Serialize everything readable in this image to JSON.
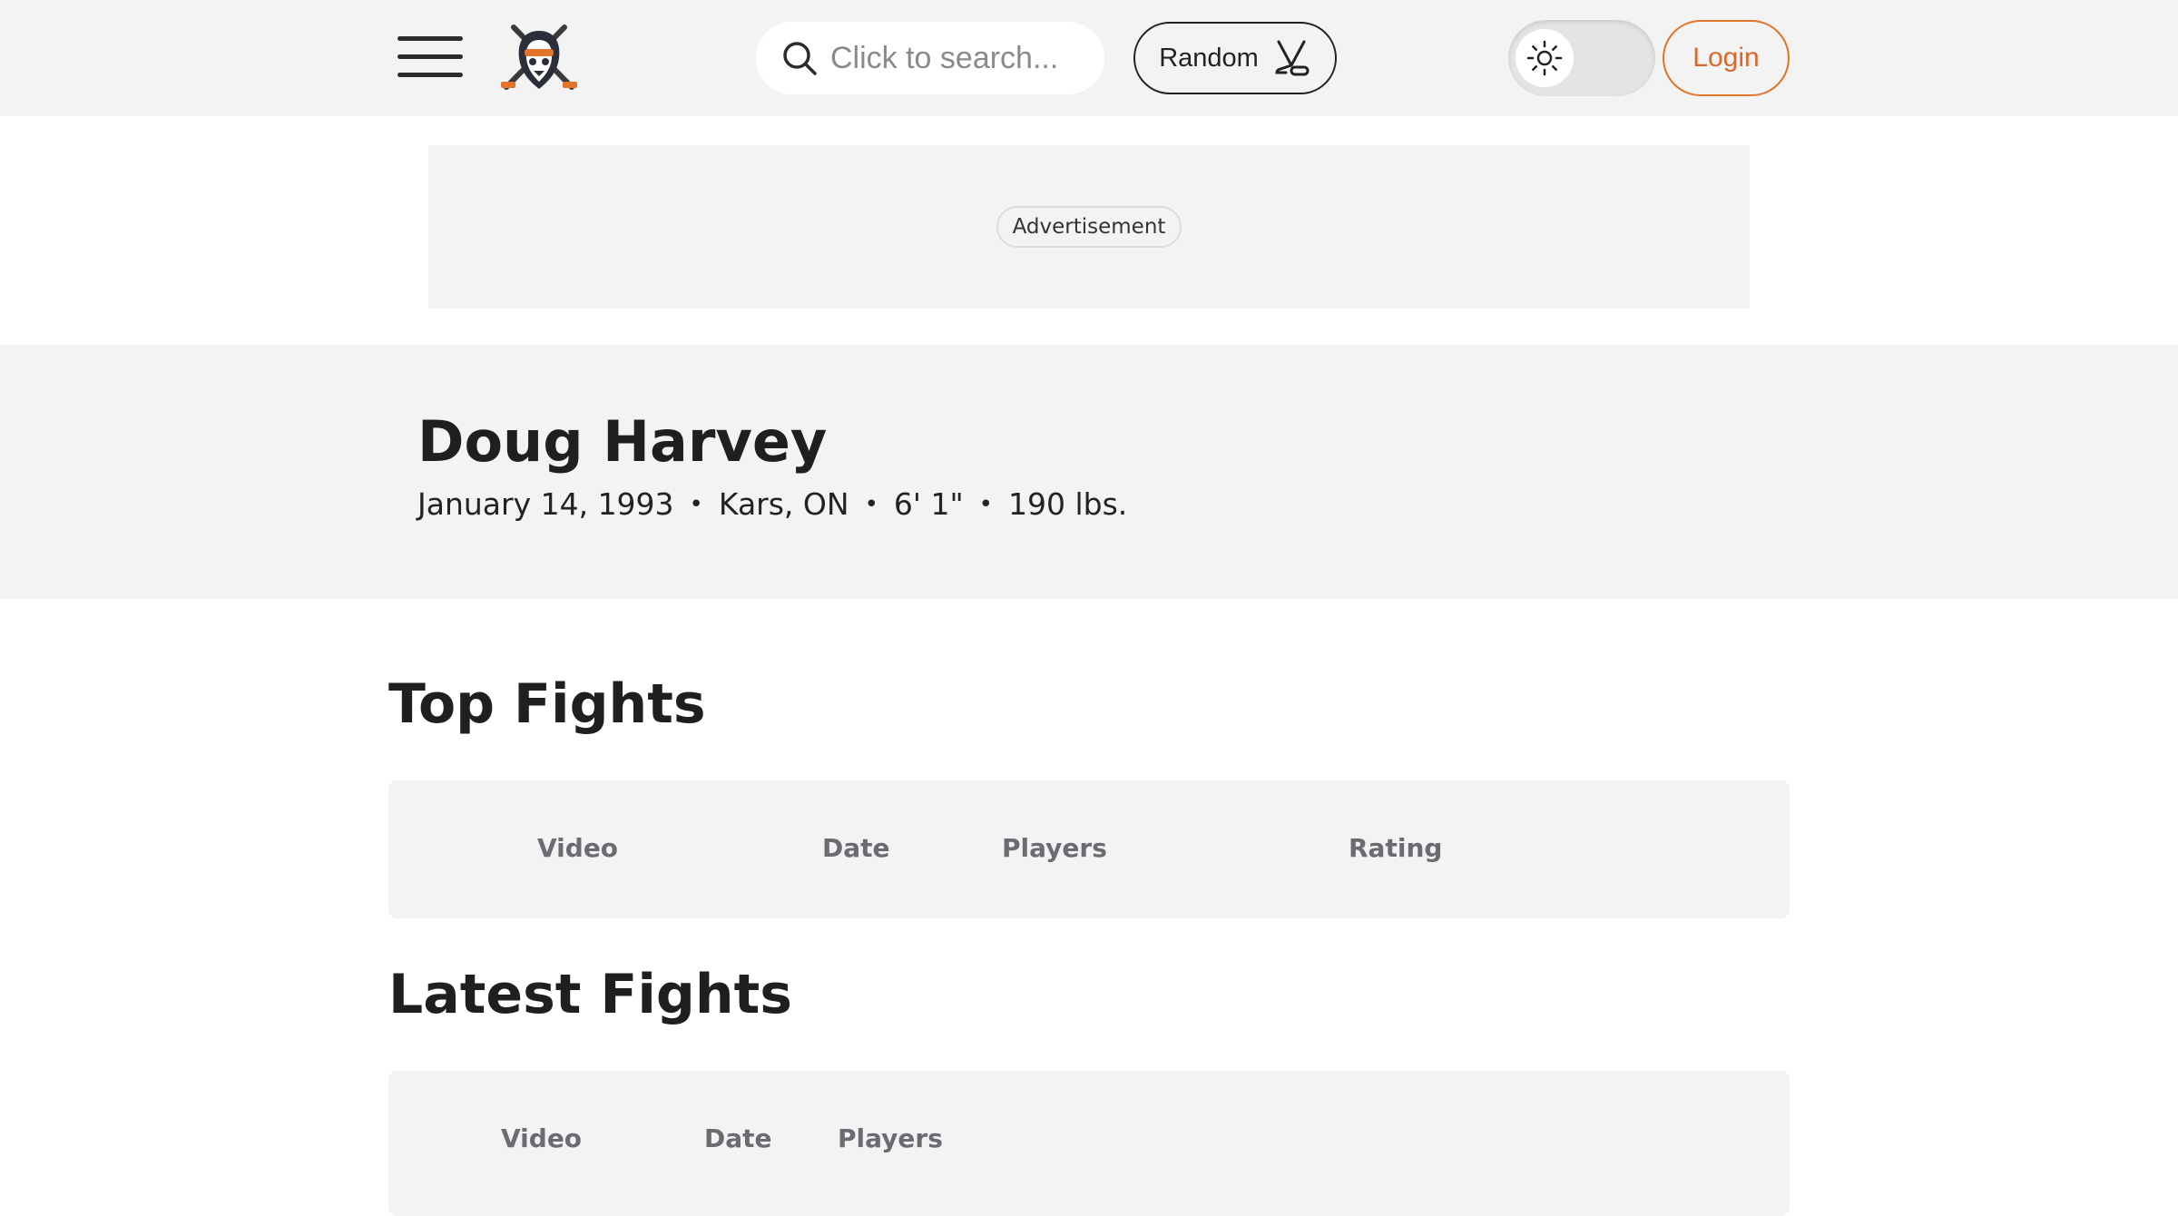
{
  "header": {
    "search_placeholder": "Click to search...",
    "random_label": "Random",
    "login_label": "Login"
  },
  "ad": {
    "label": "Advertisement"
  },
  "player": {
    "name": "Doug Harvey",
    "birth_date": "January 14, 1993",
    "hometown": "Kars, ON",
    "height": "6' 1\"",
    "weight": "190 lbs.",
    "separator": "•"
  },
  "top_fights": {
    "title": "Top Fights",
    "columns": [
      "Video",
      "Date",
      "Players",
      "Rating"
    ]
  },
  "latest_fights": {
    "title": "Latest Fights",
    "columns": [
      "Video",
      "Date",
      "Players"
    ]
  },
  "colors": {
    "accent": "#d9682a",
    "panel": "#f3f3f3",
    "text": "#1f1f1f",
    "column_header": "#6b6b72"
  },
  "icons": [
    "menu-icon",
    "site-logo",
    "search-icon",
    "hockey-sticks-icon",
    "sun-icon"
  ]
}
